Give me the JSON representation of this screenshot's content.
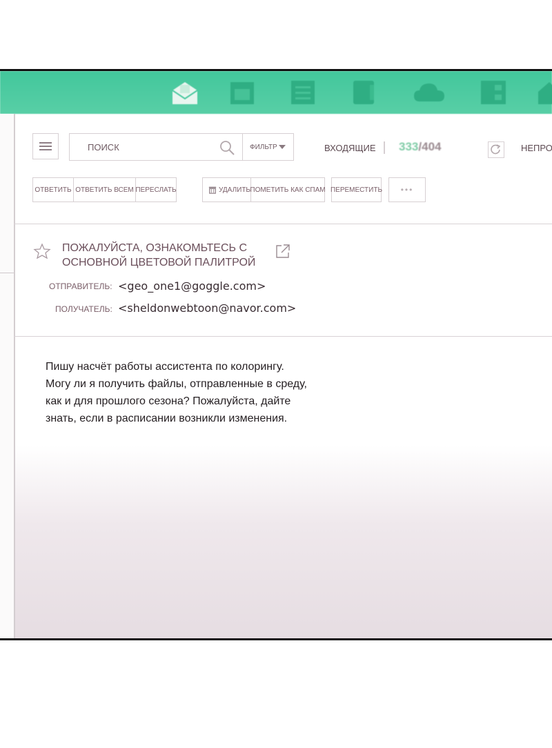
{
  "toolbar": {
    "search_label": "ПОИСК",
    "filter_label": "ФИЛЬТР",
    "inbox_label": "ВХОДЯЩИЕ",
    "count_current": "333",
    "count_sep": "/",
    "count_total": "404",
    "unread_label": "НЕПРО",
    "actions": [
      "ОТВЕТИТЬ",
      "ОТВЕТИТЬ ВСЕМ",
      "ПЕРЕСЛАТЬ",
      "УДАЛИТЬ",
      "ПОМЕТИТЬ КАК СПАМ",
      "ПЕРЕМЕСТИТЬ",
      "•••"
    ]
  },
  "message": {
    "subject_line1": "ПОЖАЛУЙСТА, ОЗНАКОМЬТЕСЬ С",
    "subject_line2": "ОСНОВНОЙ ЦВЕТОВОЙ ПАЛИТРОЙ",
    "sender_label": "ОТПРАВИТЕЛЬ:",
    "sender_value": "<geo_one1@goggle.com>",
    "recipient_label": "ПОЛУЧАТЕЛЬ:",
    "recipient_value": "<sheldonwebtoon@navor.com>",
    "body": [
      "Пишу насчёт работы ассистента по колорингу.",
      "Могу ли я получить файлы, отправленные в среду,",
      "как и для прошлого сезона? Пожалуйста, дайте",
      "знать, если в расписании возникли изменения."
    ]
  },
  "colors": {
    "topbar": "#4cc9a0",
    "accent_text": "#6b4f5b"
  },
  "icons": [
    "mail-icon",
    "calendar-icon",
    "notes-icon",
    "address-book-icon",
    "cloud-icon",
    "contacts-icon",
    "home-icon",
    "menu-icon",
    "search-icon",
    "refresh-icon",
    "trash-icon",
    "star-icon",
    "external-link-icon"
  ]
}
